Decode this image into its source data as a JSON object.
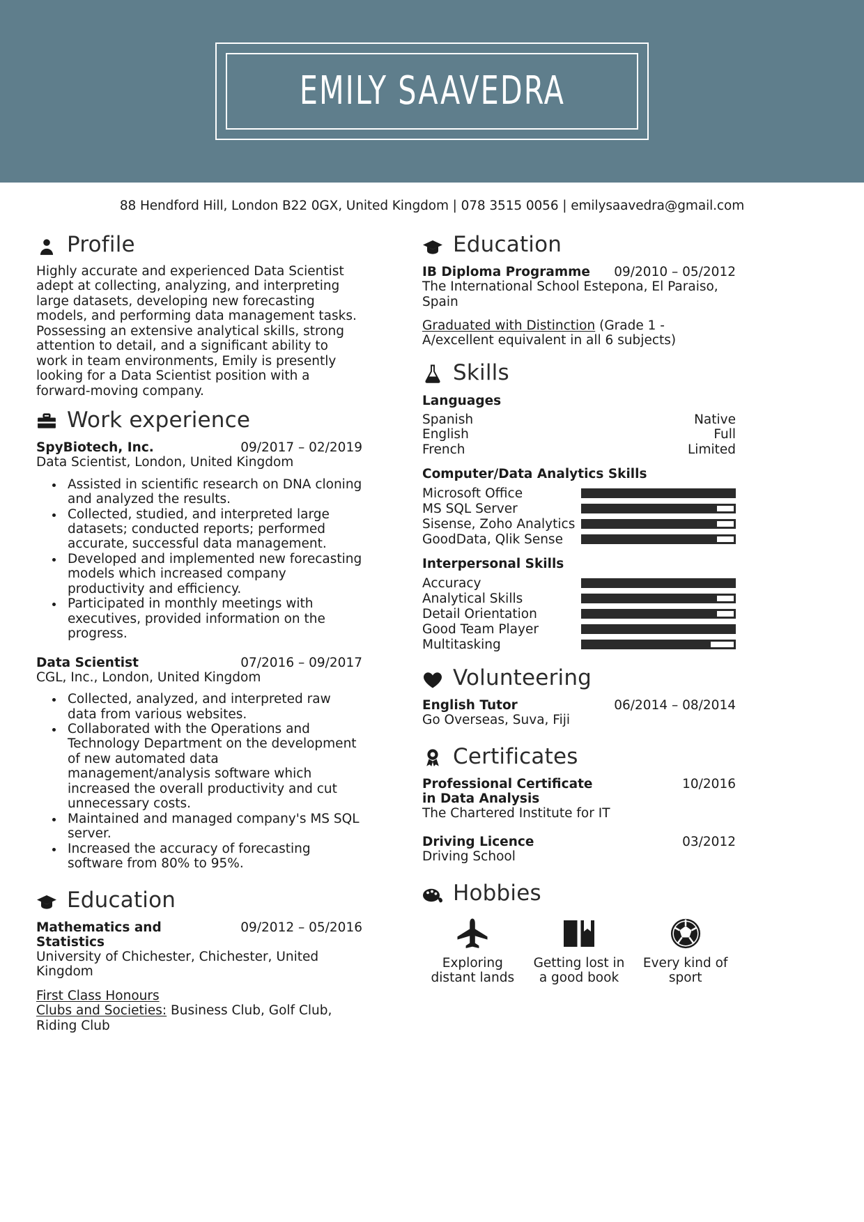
{
  "theme": {
    "banner_bg": "#5F7E8C",
    "text": "#1B1B1B",
    "bar": "#2B2B2B"
  },
  "header": {
    "full_name": "EMILY SAAVEDRA",
    "contact_line": "88 Hendford Hill, London B22 0GX, United Kingdom | 078 3515 0056 | emilysaavedra@gmail.com"
  },
  "left": {
    "profile": {
      "heading": "Profile",
      "icon": "person-icon",
      "text": "Highly accurate and experienced Data Scientist adept at collecting, analyzing, and interpreting large datasets, developing new forecasting models, and performing data management tasks. Possessing an extensive analytical skills, strong attention to detail, and a significant ability to work in team environments, Emily is presently looking for a Data Scientist position with a forward-moving company."
    },
    "work": {
      "heading": "Work experience",
      "icon": "briefcase-icon",
      "jobs": [
        {
          "title": "SpyBiotech, Inc.",
          "date": "09/2017 – 02/2019",
          "sub": "Data Scientist, London, United Kingdom",
          "bullets": [
            "Assisted in scientific research on DNA cloning and analyzed the results.",
            "Collected, studied, and interpreted large datasets; conducted reports; performed accurate, successful data management.",
            "Developed and implemented new forecasting models which increased company productivity and efficiency.",
            "Participated in monthly meetings with executives, provided information on the progress."
          ]
        },
        {
          "title": "Data Scientist",
          "date": "07/2016 – 09/2017",
          "sub": "CGL, Inc., London, United Kingdom",
          "bullets": [
            "Collected, analyzed, and interpreted raw data from various websites.",
            "Collaborated with the Operations and Technology Department on the development of new automated data management/analysis software which increased the overall productivity and cut unnecessary costs.",
            "Maintained and managed company's MS SQL server.",
            "Increased the accuracy of forecasting software from 80% to 95%."
          ]
        }
      ]
    },
    "education": {
      "heading": "Education",
      "icon": "graduation-cap-icon",
      "title": "Mathematics and Statistics",
      "date": "09/2012 – 05/2016",
      "sub": "University of Chichester, Chichester, United Kingdom",
      "honours": "First Class Honours",
      "clubs_label": "Clubs and Societies:",
      "clubs_value": " Business Club, Golf Club, Riding Club"
    }
  },
  "right": {
    "education": {
      "heading": "Education",
      "icon": "graduation-cap-icon",
      "title": "IB Diploma Programme",
      "date": "09/2010 – 05/2012",
      "sub": "The International School Estepona, El Paraiso, Spain",
      "distinction_label": "Graduated with Distinction",
      "distinction_value": " (Grade 1 - A/excellent equivalent in all 6 subjects)"
    },
    "skills": {
      "heading": "Skills",
      "icon": "flask-icon",
      "languages_head": "Languages",
      "languages": [
        {
          "name": "Spanish",
          "level": "Native"
        },
        {
          "name": "English",
          "level": "Full"
        },
        {
          "name": "French",
          "level": "Limited"
        }
      ],
      "computer_head": "Computer/Data Analytics Skills",
      "computer": [
        {
          "name": "Microsoft Office",
          "level": 100
        },
        {
          "name": "MS SQL Server",
          "level": 88
        },
        {
          "name": "Sisense, Zoho Analytics",
          "level": 88
        },
        {
          "name": "GoodData, Qlik Sense",
          "level": 88
        }
      ],
      "interpersonal_head": "Interpersonal Skills",
      "interpersonal": [
        {
          "name": "Accuracy",
          "level": 100
        },
        {
          "name": "Analytical Skills",
          "level": 88
        },
        {
          "name": "Detail Orientation",
          "level": 88
        },
        {
          "name": "Good Team Player",
          "level": 100
        },
        {
          "name": "Multitasking",
          "level": 84
        }
      ]
    },
    "volunteering": {
      "heading": "Volunteering",
      "icon": "heart-icon",
      "title": "English Tutor",
      "date": "06/2014 – 08/2014",
      "sub": "Go Overseas, Suva, Fiji"
    },
    "certificates": {
      "heading": "Certificates",
      "icon": "award-ribbon-icon",
      "items": [
        {
          "title": "Professional Certificate in Data Analysis",
          "date": "10/2016",
          "sub": "The Chartered Institute for IT"
        },
        {
          "title": "Driving Licence",
          "date": "03/2012",
          "sub": "Driving School"
        }
      ]
    },
    "hobbies": {
      "heading": "Hobbies",
      "icon": "palette-icon",
      "items": [
        {
          "icon": "airplane-icon",
          "label": "Exploring distant lands"
        },
        {
          "icon": "open-book-icon",
          "label": "Getting lost in a good book"
        },
        {
          "icon": "soccer-ball-icon",
          "label": "Every kind of sport"
        }
      ]
    }
  }
}
